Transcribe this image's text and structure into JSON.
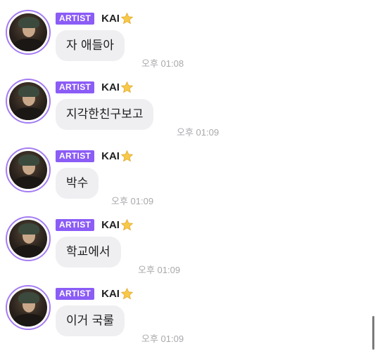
{
  "messages": [
    {
      "badge": "ARTIST",
      "author": "KAI",
      "text": "자 애들아",
      "time": "오후 01:08"
    },
    {
      "badge": "ARTIST",
      "author": "KAI",
      "text": "지각한친구보고",
      "time": "오후 01:09"
    },
    {
      "badge": "ARTIST",
      "author": "KAI",
      "text": "박수",
      "time": "오후 01:09"
    },
    {
      "badge": "ARTIST",
      "author": "KAI",
      "text": "학교에서",
      "time": "오후 01:09"
    },
    {
      "badge": "ARTIST",
      "author": "KAI",
      "text": "이거 국룰",
      "time": "오후 01:09"
    }
  ],
  "icons": {
    "author_suffix": "star-icon",
    "avatar": "profile-photo"
  },
  "colors": {
    "badge": "#8b5cf6",
    "avatar_ring": "#a47cf2",
    "bubble": "#efeff2",
    "time": "#a9a9ae",
    "star": "#f7c948"
  }
}
